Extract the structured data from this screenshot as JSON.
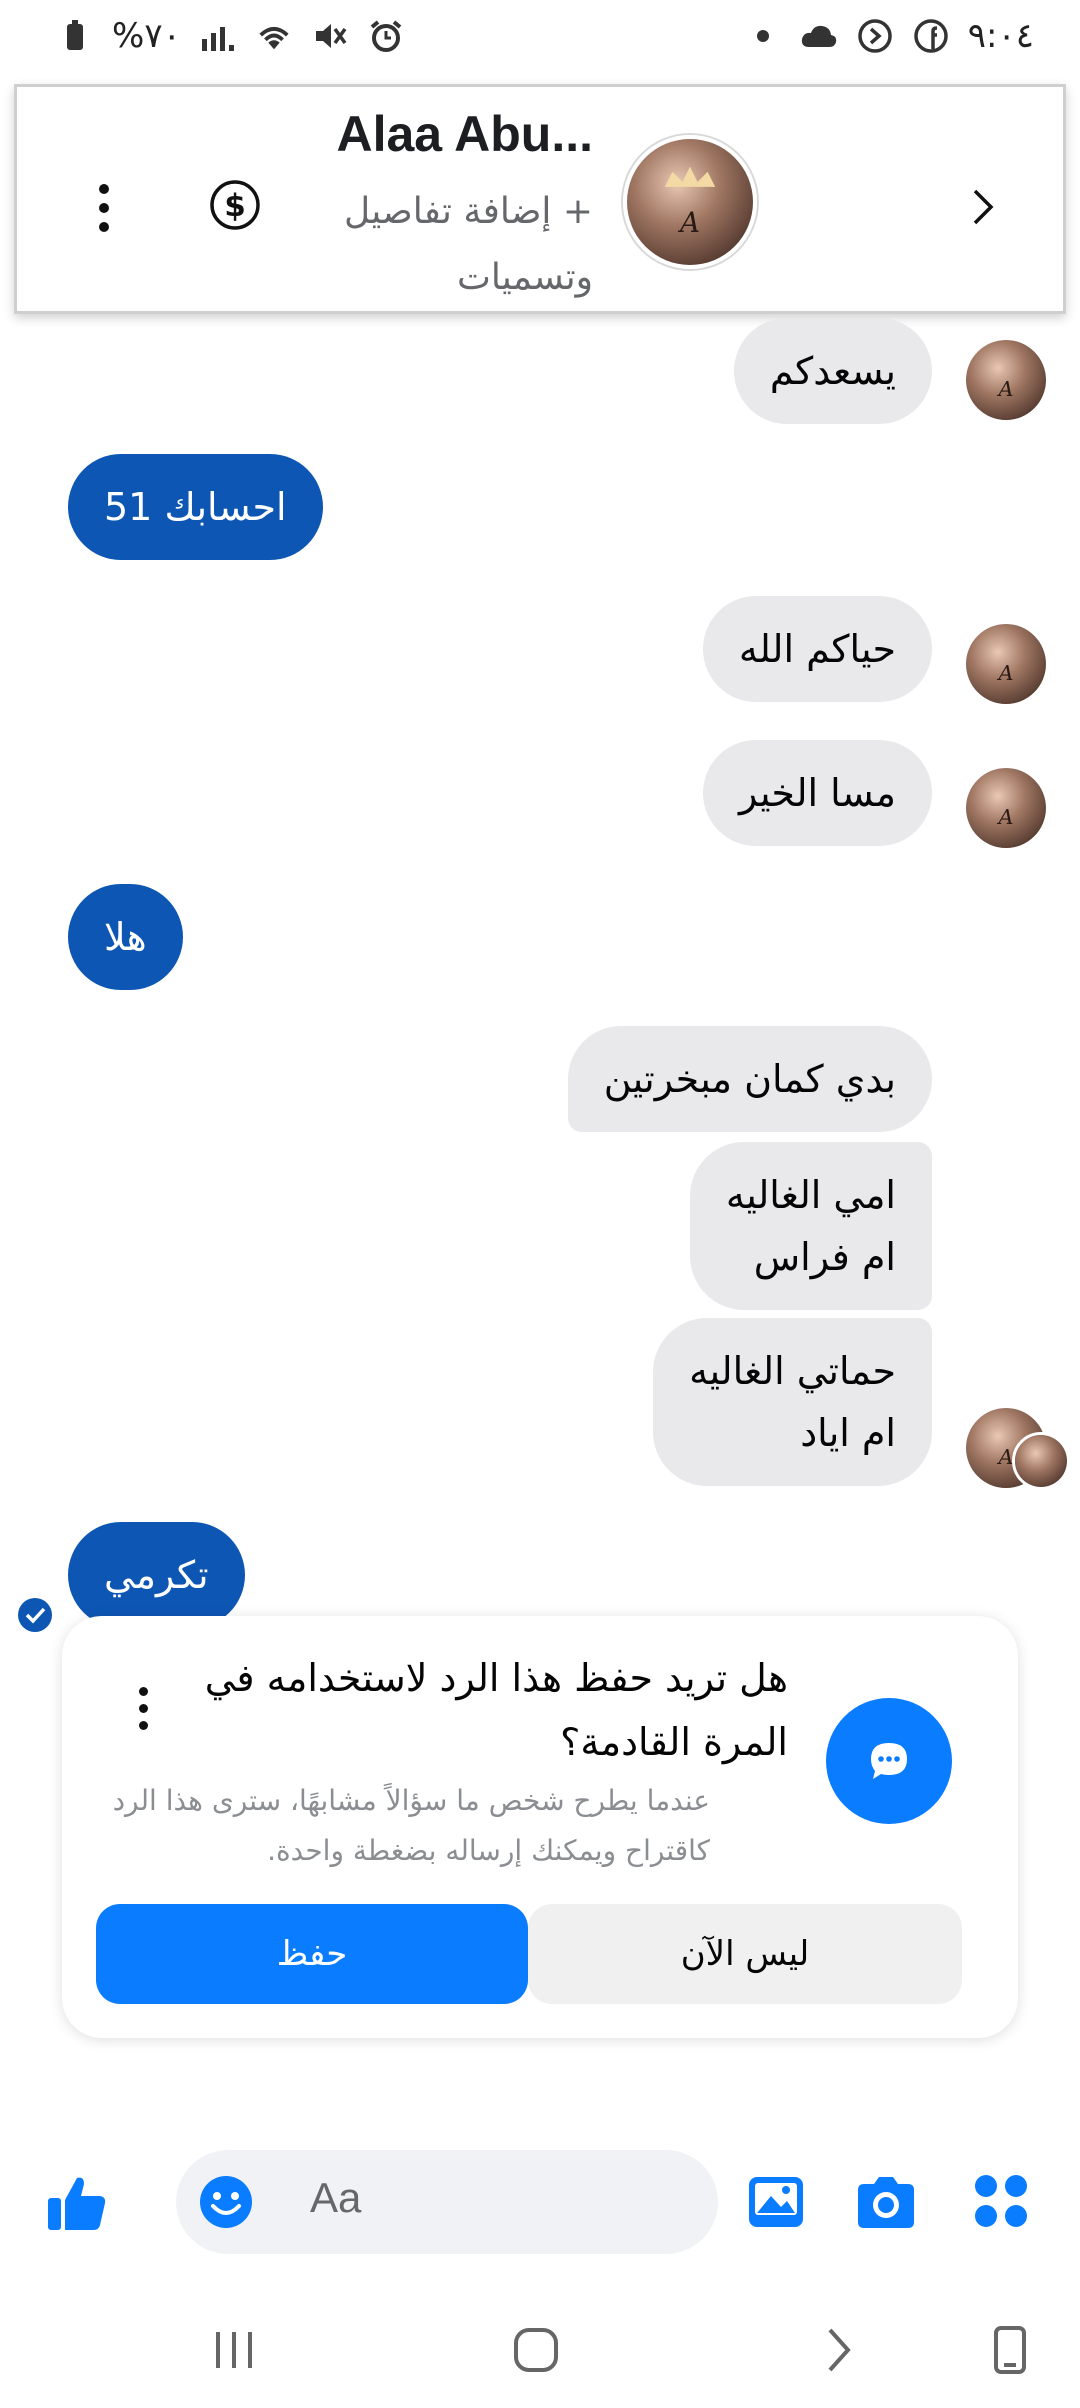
{
  "status_bar": {
    "battery": "%٧٠",
    "time": "٩:٠٤"
  },
  "header": {
    "contact_name": "Alaa Abu...",
    "subtitle": "+ إضافة تفاصيل وتسميات"
  },
  "messages": [
    {
      "direction": "in",
      "text": "يسعدكم"
    },
    {
      "direction": "out",
      "text": "احسابك 51"
    },
    {
      "direction": "in",
      "text": "حياكم الله"
    },
    {
      "direction": "in",
      "text": "مسا الخير"
    },
    {
      "direction": "out",
      "text": "هلا"
    },
    {
      "direction": "in",
      "text": "بدي كمان مبخرتين"
    },
    {
      "direction": "in",
      "text": "امي الغاليه\nام فراس"
    },
    {
      "direction": "in",
      "text": "حماتي الغاليه\nام اياد"
    },
    {
      "direction": "out",
      "text": "تكرمي"
    }
  ],
  "save_reply_card": {
    "title": "هل تريد حفظ هذا الرد لاستخدامه في المرة القادمة؟",
    "description": "عندما يطرح شخص ما سؤالاً مشابهًا، سترى هذا الرد كاقتراح ويمكنك إرساله بضغطة واحدة.",
    "save_label": "حفظ",
    "not_now_label": "ليس الآن"
  },
  "composer": {
    "placeholder": "Aa"
  },
  "colors": {
    "outgoing_bubble": "#0d56b4",
    "incoming_bubble": "#e9e9eb",
    "accent": "#0a7cff"
  }
}
